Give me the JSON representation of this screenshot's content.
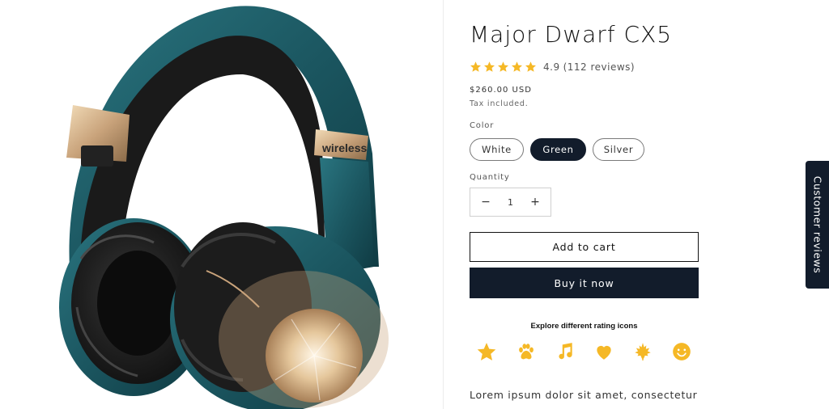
{
  "product": {
    "title": "Major Dwarf CX5",
    "image_label": "wireless",
    "rating": {
      "score": "4.9",
      "reviews": "(112 reviews)",
      "stars": 5,
      "star_color": "#f5b826"
    },
    "price": "$260.00 USD",
    "tax_note": "Tax included."
  },
  "variants": {
    "label": "Color",
    "options": [
      "White",
      "Green",
      "Silver"
    ],
    "selected": "Green"
  },
  "quantity": {
    "label": "Quantity",
    "value": "1",
    "minus": "−",
    "plus": "+"
  },
  "actions": {
    "add_to_cart": "Add to cart",
    "buy_now": "Buy it now"
  },
  "rating_icons": {
    "heading": "Explore different rating icons",
    "icons": [
      "star-icon",
      "paw-icon",
      "music-note-icon",
      "heart-icon",
      "leaf-icon",
      "smiley-icon"
    ],
    "color": "#f5b826"
  },
  "description": {
    "text": "Lorem ipsum dolor sit amet, consectetur"
  },
  "side_tab": {
    "label": "Customer reviews"
  },
  "colors": {
    "accent_dark": "#121c2b",
    "headphone_teal": "#1c5a63",
    "headphone_gold": "#c9a37b"
  }
}
